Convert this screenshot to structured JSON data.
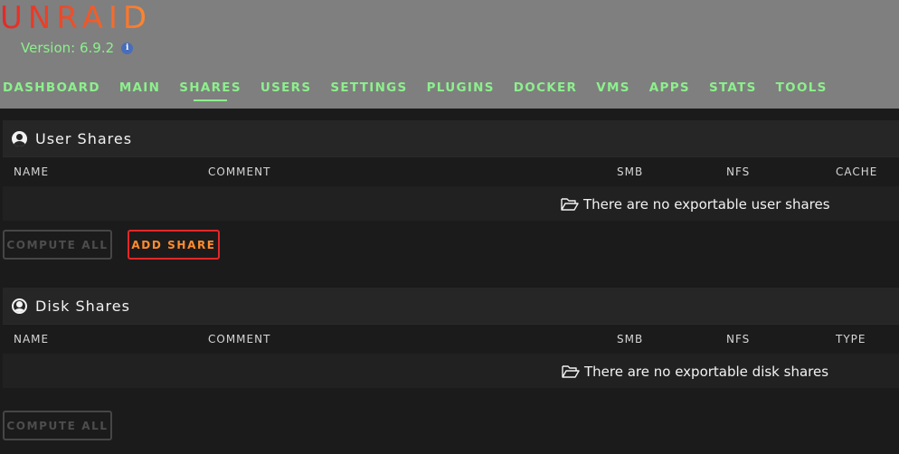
{
  "header": {
    "logo": "UNRAID",
    "version": "Version: 6.9.2",
    "version_info_icon": "info-icon"
  },
  "nav": {
    "items": [
      "DASHBOARD",
      "MAIN",
      "SHARES",
      "USERS",
      "SETTINGS",
      "PLUGINS",
      "DOCKER",
      "VMS",
      "APPS",
      "STATS",
      "TOOLS"
    ],
    "active": "SHARES"
  },
  "user_shares": {
    "title": "User Shares",
    "icon": "user-circle-icon",
    "columns": [
      "NAME",
      "COMMENT",
      "SMB",
      "NFS",
      "CACHE"
    ],
    "empty_message": "There are no exportable user shares",
    "compute_all_label": "COMPUTE ALL",
    "add_share_label": "ADD SHARE"
  },
  "disk_shares": {
    "title": "Disk Shares",
    "icon": "user-circle-outline-icon",
    "columns": [
      "NAME",
      "COMMENT",
      "SMB",
      "NFS",
      "TYPE"
    ],
    "empty_message": "There are no exportable disk shares",
    "compute_all_label": "COMPUTE ALL"
  },
  "colors": {
    "header_bg": "#7f7f7f",
    "nav_text": "#8cf08c",
    "accent_red": "#e22828",
    "accent_orange": "#ff8c2f",
    "page_bg": "#1c1b1b"
  }
}
